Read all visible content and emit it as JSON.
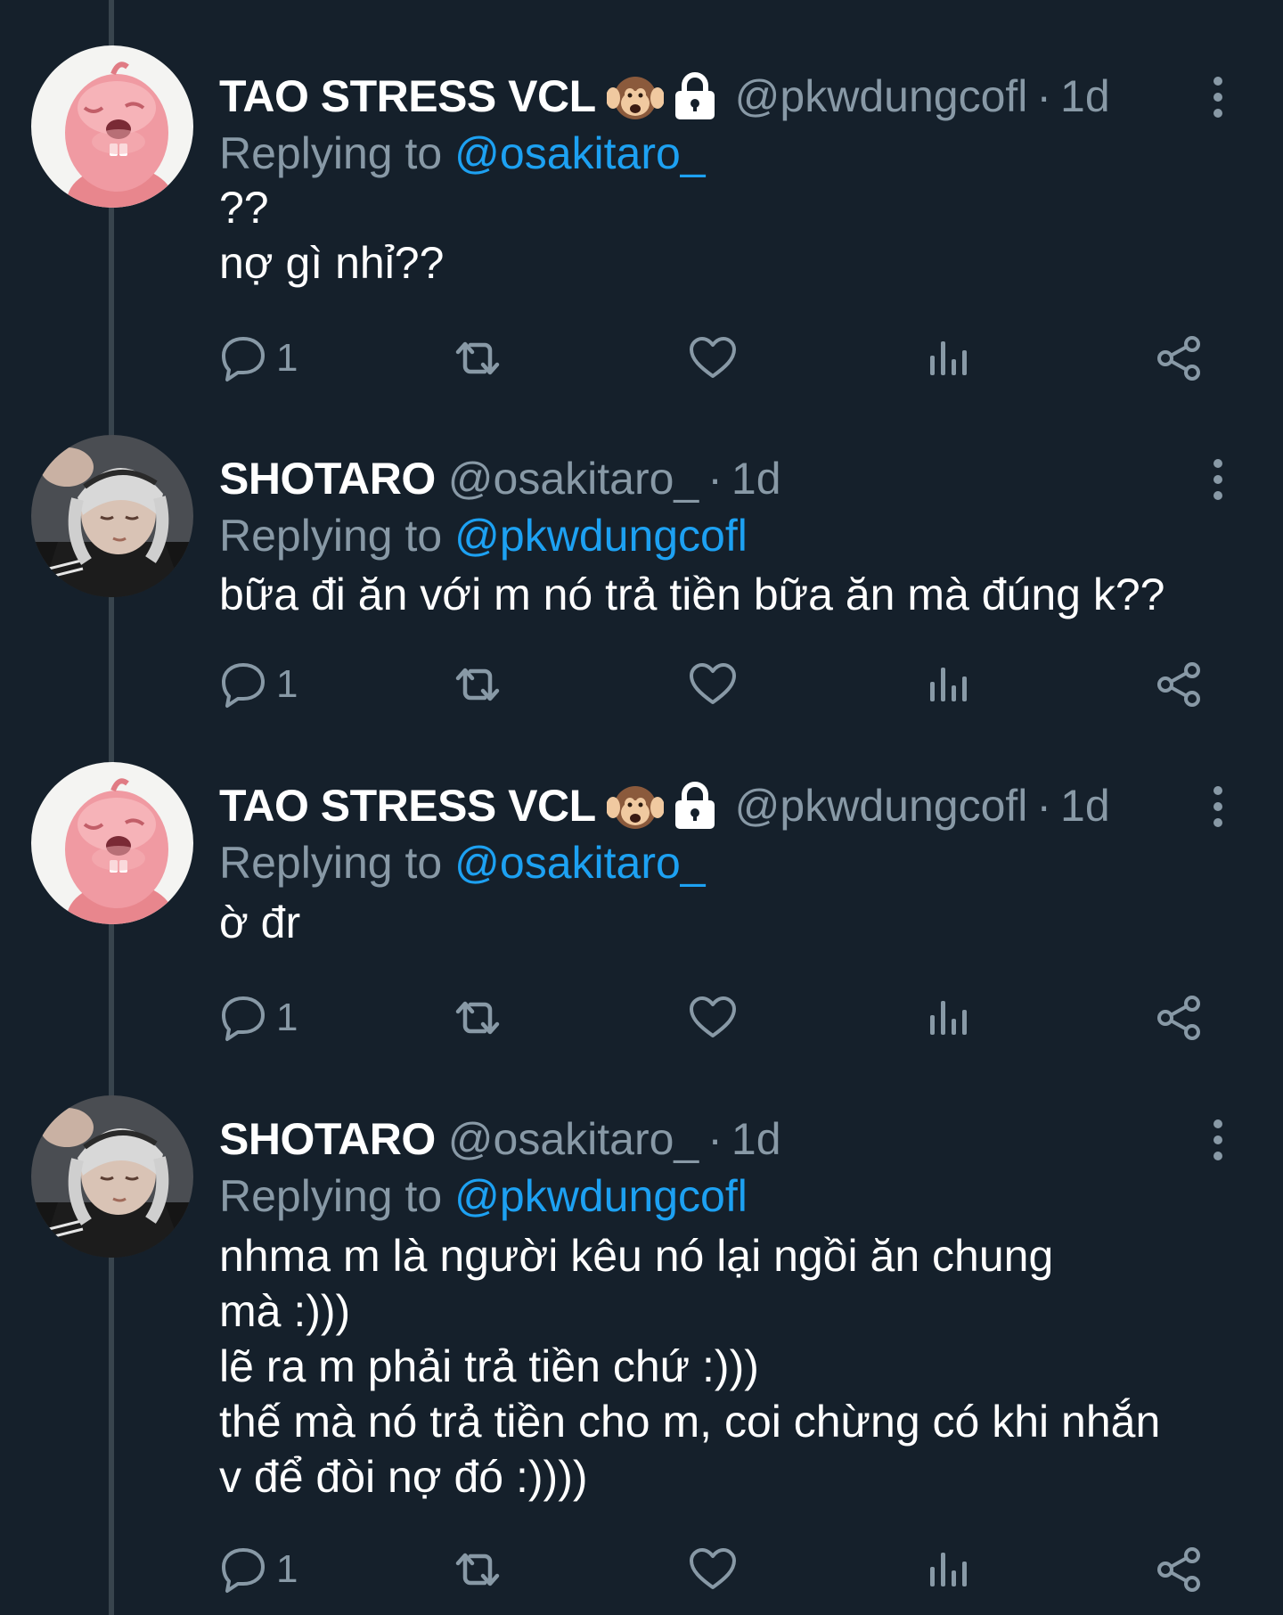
{
  "tweets": [
    {
      "name": "TAO STRESS VCL",
      "emoji": "hear-no-evil-monkey-icon",
      "locked": true,
      "handle": "@pkwdungcofl",
      "separator": "·",
      "time": "1d",
      "replying_prefix": "Replying to",
      "replying_to": "@osakitaro_",
      "body": "??\nnợ gì nhỉ??",
      "reply_count": "1",
      "avatar": "pink-beaver-avatar"
    },
    {
      "name": "SHOTARO",
      "handle": "@osakitaro_",
      "separator": "·",
      "time": "1d",
      "replying_prefix": "Replying to",
      "replying_to": "@pkwdungcofl",
      "body": "bữa đi ăn với m nó trả tiền bữa ăn mà đúng k??",
      "reply_count": "1",
      "avatar": "person-photo-avatar"
    },
    {
      "name": "TAO STRESS VCL",
      "emoji": "hear-no-evil-monkey-icon",
      "locked": true,
      "handle": "@pkwdungcofl",
      "separator": "·",
      "time": "1d",
      "replying_prefix": "Replying to",
      "replying_to": "@osakitaro_",
      "body": "ờ đr",
      "reply_count": "1",
      "avatar": "pink-beaver-avatar"
    },
    {
      "name": "SHOTARO",
      "handle": "@osakitaro_",
      "separator": "·",
      "time": "1d",
      "replying_prefix": "Replying to",
      "replying_to": "@pkwdungcofl",
      "body": "nhma m là người kêu nó lại ngồi ăn chung\nmà :)))\nlẽ ra m phải trả tiền chứ :)))\nthế mà nó trả tiền cho m, coi chừng có khi nhắn\nv để đòi nợ đó :))))",
      "reply_count": "1",
      "avatar": "person-photo-avatar"
    }
  ],
  "colors": {
    "background": "#15202b",
    "muted": "#8899a6",
    "link": "#1da1f2",
    "thread_line": "#38444d"
  }
}
